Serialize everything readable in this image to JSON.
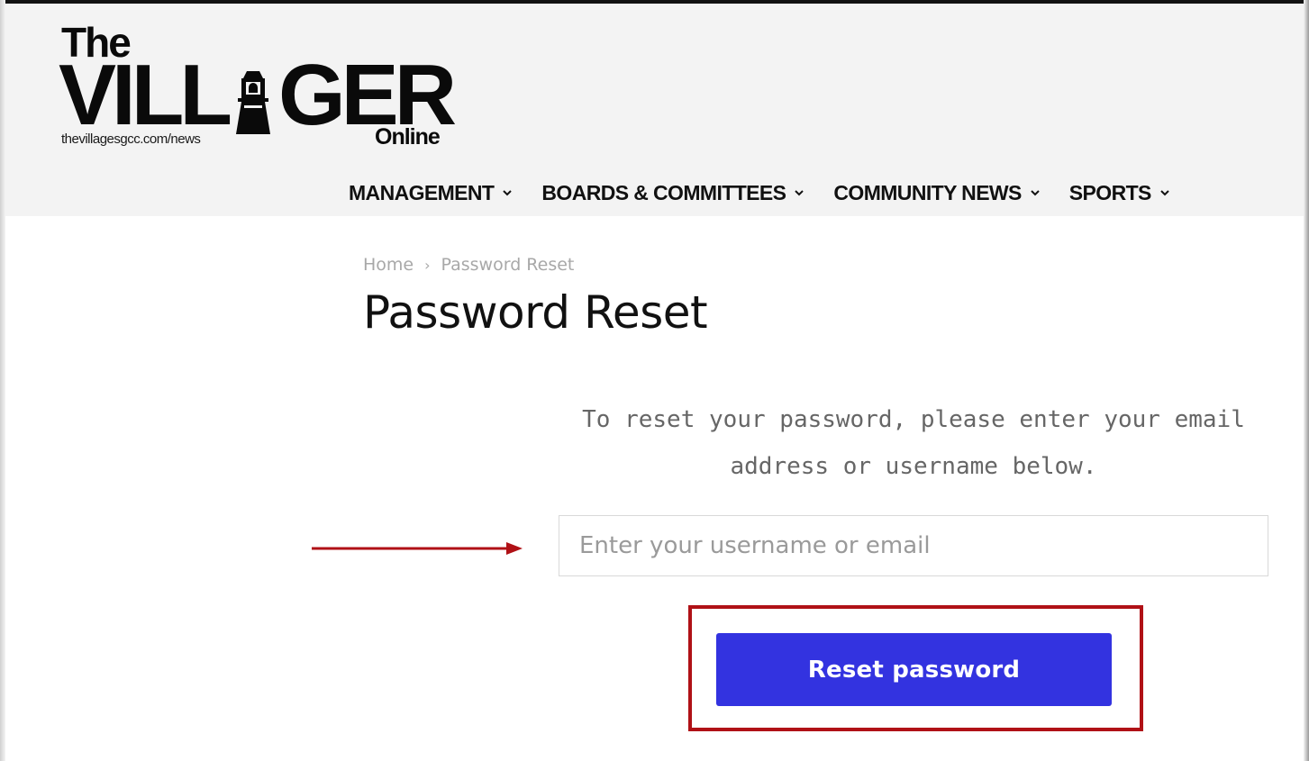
{
  "logo": {
    "the": "The",
    "villager_left": "VILL",
    "villager_right": "GER",
    "url": "thevillagesgcc.com/news",
    "online": "Online"
  },
  "nav": {
    "items": [
      {
        "label": "MANAGEMENT"
      },
      {
        "label": "BOARDS & COMMITTEES"
      },
      {
        "label": "COMMUNITY NEWS"
      },
      {
        "label": "SPORTS"
      }
    ]
  },
  "breadcrumb": {
    "home": "Home",
    "separator": "›",
    "current": "Password Reset"
  },
  "page": {
    "title": "Password Reset",
    "instructions_line1": "To reset your password, please enter your email",
    "instructions_line2": "address or username below."
  },
  "form": {
    "input_placeholder": "Enter your username or email",
    "input_value": "",
    "submit_label": "Reset password"
  },
  "colors": {
    "header_bg": "#f3f3f3",
    "button_bg": "#3333e0",
    "annotation_red": "#b01116",
    "breadcrumb": "#a8a8a8"
  },
  "icons": {
    "nav_dropdown": "chevron-down-icon",
    "logo_mark": "lighthouse-icon",
    "annotation": "arrow-right-icon"
  }
}
